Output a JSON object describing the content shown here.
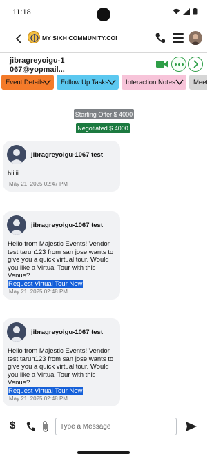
{
  "status_bar": {
    "time": "11:18"
  },
  "header": {
    "app_title": "MY SIKH COMMUNITY.COM"
  },
  "contact": {
    "name": "jibragreyoigu-1067@yopmail..."
  },
  "tabs": [
    {
      "label": "Event Details",
      "color": "#f47b2a"
    },
    {
      "label": "Follow Up Tasks",
      "color": "#5bc8f0"
    },
    {
      "label": "Interaction Notes",
      "color": "#f7c4d9"
    },
    {
      "label": "Meet",
      "color": "#d6d6d6"
    }
  ],
  "badges": {
    "starting_offer": "Starting Offer $ 4000",
    "negotiated": "Negotiated $ 4000"
  },
  "messages": [
    {
      "sender": "jibragreyoigu-1067 test",
      "text": "hiiiii",
      "link": "",
      "time": "May 21, 2025 02:47 PM"
    },
    {
      "sender": "jibragreyoigu-1067 test",
      "text": "Hello from Majestic Events! Vendor test tarun123 from san jose wants to give you a quick virtual tour. Would you like a Virtual Tour with this Venue?",
      "link": "Request Virtual Tour Now",
      "time": "May 21, 2025 02:48 PM"
    },
    {
      "sender": "jibragreyoigu-1067 test",
      "text": "Hello from Majestic Events! Vendor test tarun123 from san jose wants to give you a quick virtual tour. Would you like a Virtual Tour with this Venue?",
      "link": "Request Virtual Tour Now",
      "time": "May 21, 2025 02:48 PM"
    }
  ],
  "composer": {
    "dollar_symbol": "$",
    "placeholder": "Type a Message"
  },
  "colors": {
    "accent_green": "#2e9e47",
    "link_blue": "#1560d9",
    "offer_gray": "#7d8185",
    "negotiated_green": "#1c7a40"
  }
}
